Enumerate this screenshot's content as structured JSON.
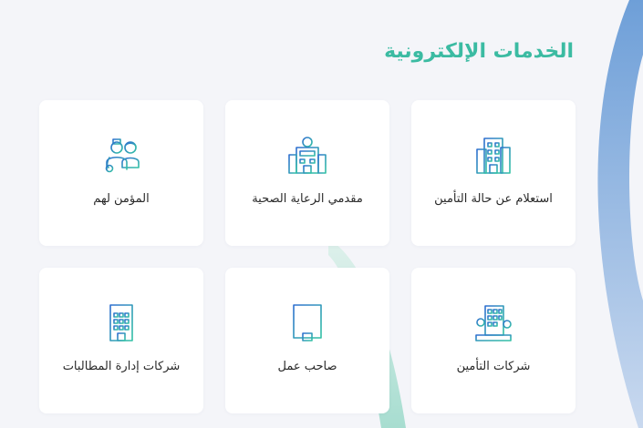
{
  "section": {
    "title": "الخدمات الإلكترونية"
  },
  "colors": {
    "accent": "#3bbba2",
    "icon_blue": "#2f6fd0",
    "icon_teal": "#33c2a5",
    "background": "#f4f5f9",
    "card": "#ffffff"
  },
  "services": [
    {
      "label": "استعلام عن حالة التأمين",
      "icon": "office-building-icon"
    },
    {
      "label": "مقدمي الرعاية الصحية",
      "icon": "hospital-icon"
    },
    {
      "label": "المؤمن لهم",
      "icon": "insured-people-icon"
    },
    {
      "label": "شركات التأمين",
      "icon": "company-building-trees-icon"
    },
    {
      "label": "صاحب عمل",
      "icon": "document-building-icon"
    },
    {
      "label": "شركات إدارة المطالبات",
      "icon": "apartment-building-icon"
    }
  ]
}
